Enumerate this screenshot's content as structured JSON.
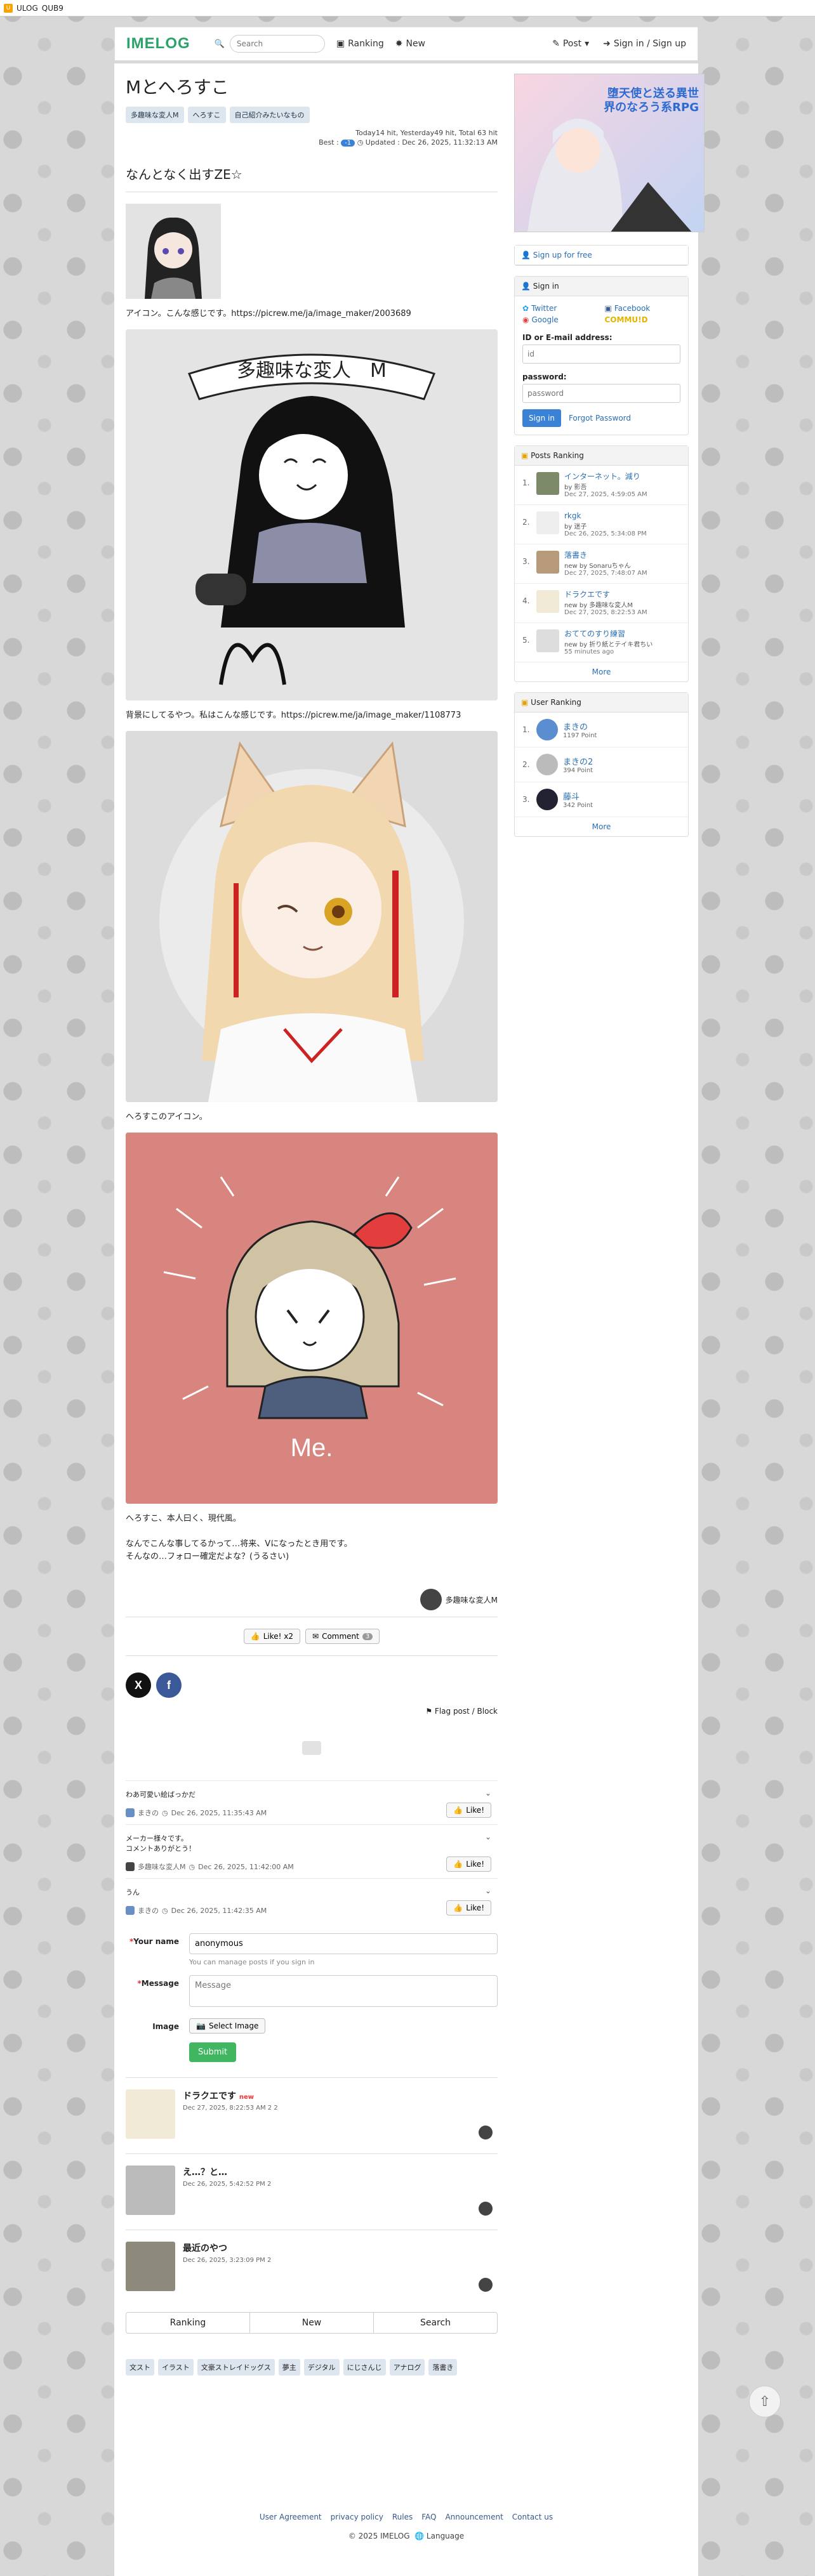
{
  "appbar": {
    "title": "ULOG",
    "subtitle": "QUB9"
  },
  "nav": {
    "logo": "IMELOG",
    "search_placeholder": "Search",
    "ranking": "Ranking",
    "new": "New",
    "post": "Post",
    "signin": "Sign in / Sign up"
  },
  "post": {
    "title": "Mとへろすこ",
    "tags": [
      "多趣味な変人M",
      "へろすこ",
      "自己紹介みたいなもの"
    ],
    "stats_line1": "Today14 hit,  Yesterday49 hit,  Total 63 hit",
    "best_label": "Best :",
    "best_badge": "-1",
    "updated": "Updated : Dec 26, 2025, 11:32:13 AM",
    "heading": "なんとなく出すZE☆",
    "p1": "アイコン。こんな感じです。https://picrew.me/ja/image_maker/2003689",
    "p2": "背景にしてるやつ。私はこんな感じです。https://picrew.me/ja/image_maker/1108773",
    "p3": "へろすこのアイコン。",
    "p4a": "へろすこ、本人曰く、現代風。",
    "p4b": "なんでこんな事してるかって…将来、Vになったとき用です。",
    "p4c": "そんなの…フォロー確定だよな？(うるさい)",
    "img1_banner": "多趣味な変人　M",
    "img3_text": "Me.",
    "author": "多趣味な変人M",
    "like_label": "Like! x2",
    "comment_label": "Comment",
    "comment_count": "3",
    "flag_label": "Flag post / Block"
  },
  "comments": [
    {
      "text": "わあ可愛い絵ばっかだ",
      "user": "まきの",
      "time": "Dec 26, 2025, 11:35:43 AM",
      "like": "Like!"
    },
    {
      "text": "メーカー様々です。\nコメントありがとう！",
      "user": "多趣味な変人M",
      "time": "Dec 26, 2025, 11:42:00 AM",
      "like": "Like!"
    },
    {
      "text": "うん",
      "user": "まきの",
      "time": "Dec 26, 2025, 11:42:35 AM",
      "like": "Like!"
    }
  ],
  "form": {
    "name_label": "Your name",
    "name_value": "anonymous",
    "name_hint": "You can manage posts if you sign in",
    "message_label": "Message",
    "message_placeholder": "Message",
    "image_label": "Image",
    "select_image": "Select Image",
    "submit": "Submit"
  },
  "related": [
    {
      "title": "ドラクエです",
      "tag": "new",
      "meta": "Dec 27, 2025, 8:22:53 AM  2  2"
    },
    {
      "title": "え…？と…",
      "tag": "",
      "meta": "Dec 26, 2025, 5:42:52 PM  2"
    },
    {
      "title": "最近のやつ",
      "tag": "",
      "meta": "Dec 26, 2025, 3:23:09 PM  2"
    }
  ],
  "bottom_tabs": [
    "Ranking",
    "New",
    "Search"
  ],
  "bottom_tags": [
    "文スト",
    "イラスト",
    "文豪ストレイドッグス",
    "夢主",
    "デジタル",
    "にじさんじ",
    "アナログ",
    "落書き"
  ],
  "footer": {
    "links": [
      "User Agreement",
      "privacy policy",
      "Rules",
      "FAQ",
      "Announcement",
      "Contact us"
    ],
    "copyright": "© 2025  IMELOG",
    "language": "Language"
  },
  "sidebar": {
    "ad_text": "堕天使と送る異世界のなろう系RPG",
    "signup": "Sign up for free",
    "signin_title": "Sign in",
    "twitter": "Twitter",
    "facebook": "Facebook",
    "google": "Google",
    "communo": "COMMU!D",
    "id_label": "ID or E-mail address:",
    "id_placeholder": "id",
    "pw_label": "password:",
    "pw_placeholder": "password",
    "signin_btn": "Sign in",
    "forgot": "Forgot Password",
    "posts_ranking_title": "Posts Ranking",
    "posts_ranking": [
      {
        "n": "1.",
        "title": "インターネット。減り",
        "by": "by 影吾",
        "when": "Dec 27, 2025, 4:59:05 AM"
      },
      {
        "n": "2.",
        "title": "rkgk",
        "by": "by 迷子",
        "when": "Dec 26, 2025, 5:34:08 PM"
      },
      {
        "n": "3.",
        "title": "落書き",
        "by": "new  by Sonaruちゃん",
        "when": "Dec 27, 2025, 7:48:07 AM"
      },
      {
        "n": "4.",
        "title": "ドラクエです",
        "by": "new  by 多趣味な変人M",
        "when": "Dec 27, 2025, 8:22:53 AM"
      },
      {
        "n": "5.",
        "title": "おててのすり練習",
        "by": "new  by 折り紙とテイキ君ちい",
        "when": "55 minutes ago"
      }
    ],
    "more": "More",
    "user_ranking_title": "User Ranking",
    "user_ranking": [
      {
        "n": "1.",
        "name": "まきの",
        "point": "1197 Point"
      },
      {
        "n": "2.",
        "name": "まきの2",
        "point": "394 Point"
      },
      {
        "n": "3.",
        "name": "藤斗",
        "point": "342 Point"
      }
    ]
  }
}
